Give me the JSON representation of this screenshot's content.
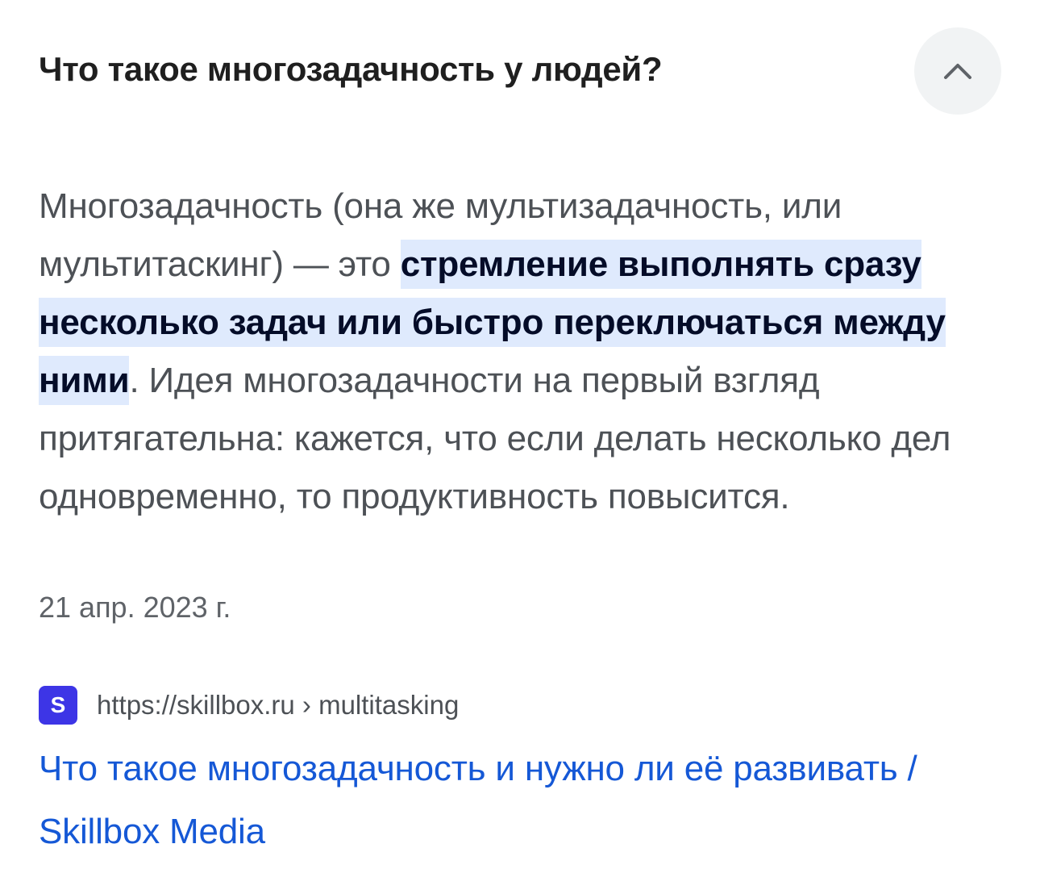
{
  "question": {
    "title": "Что такое многозадачность у людей?",
    "toggle_icon": "chevron-up-icon"
  },
  "answer": {
    "text_before": "Многозадачность (она же мультизадачность, или мультитаскинг) — это ",
    "highlight": "стремление выполнять сразу несколько задач или быстро переключаться между ними",
    "text_after": ". Идея многозадачности на первый взгляд притягательна: кажется, что если делать несколько дел одновременно, то продуктивность повысится.",
    "date": "21 апр. 2023 г."
  },
  "source": {
    "favicon_letter": "S",
    "favicon_color": "#3d35e6",
    "url": "https://skillbox.ru › multitasking"
  },
  "result": {
    "title": "Что такое многозадачность и нужно ли её развивать / Skillbox Media",
    "link_color": "#1558d6"
  },
  "colors": {
    "highlight_bg": "#dfeafd",
    "button_bg": "#f1f3f4"
  }
}
